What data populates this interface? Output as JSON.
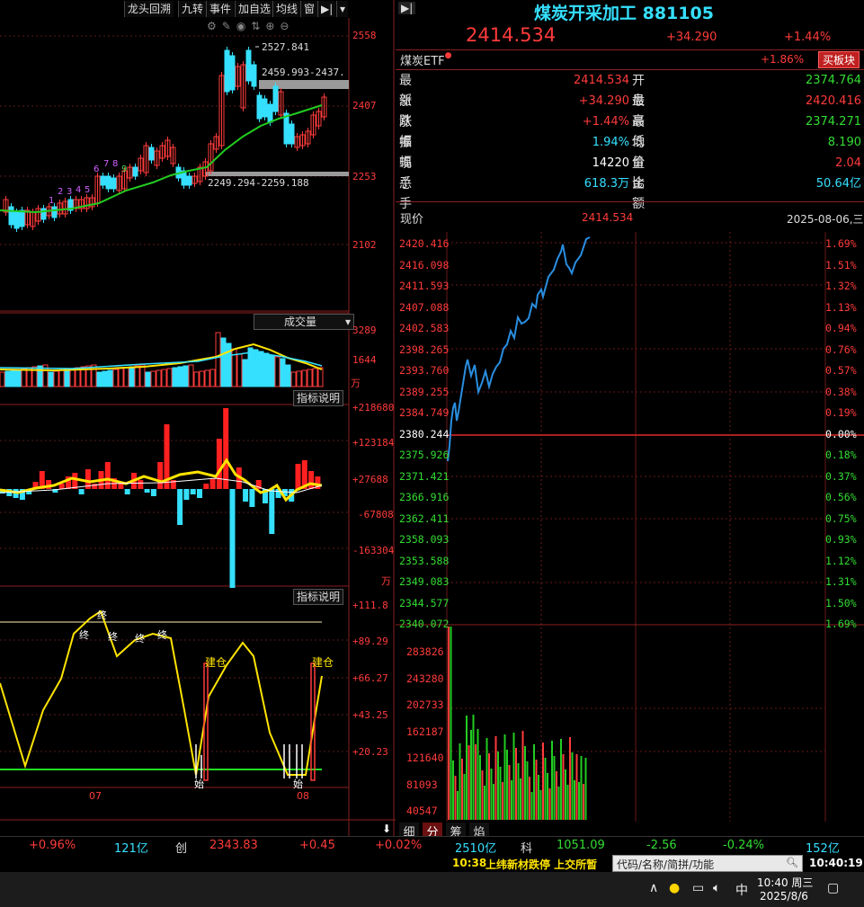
{
  "toolbar": {
    "buttons": [
      "龙头回溯",
      "九转",
      "事件",
      "加自选",
      "均线",
      "窗"
    ],
    "arrow_icon": "▶|",
    "dropdown_icon": "▾"
  },
  "kline": {
    "price_axis": [
      "2558",
      "2407",
      "2253",
      "2102"
    ],
    "high_label": "2527.841",
    "resistance_label": "2459.993-2437.",
    "support_label": "2249.294-2259.188",
    "seq_numbers": [
      "1",
      "2",
      "3",
      "4",
      "5",
      "6",
      "7",
      "8",
      "9"
    ],
    "month_labels": [
      "07",
      "08"
    ]
  },
  "volume": {
    "selector_label": "成交量",
    "axis": [
      "3289",
      "1644"
    ],
    "unit": "万"
  },
  "indicator1": {
    "button_label": "指标说明",
    "axis": [
      "+218680",
      "+123184",
      "+27688",
      "-67808",
      "-163304"
    ],
    "unit": "万"
  },
  "indicator2": {
    "button_label": "指标说明",
    "axis": [
      "+111.8",
      "+89.29",
      "+66.27",
      "+43.25",
      "+20.23"
    ],
    "build_label": "建仓",
    "top_label": "终",
    "bottom_label": "始"
  },
  "header": {
    "title": "煤炭开采加工 881105",
    "price": "2414.534",
    "change": "+34.290",
    "change_pct": "+1.44%"
  },
  "etf": {
    "name": "煤炭ETF",
    "change_pct": "+1.86%",
    "button": "买板块"
  },
  "quote": {
    "rows": [
      {
        "l1": "最新",
        "v1": "2414.534",
        "c1": "red",
        "l2": "开盘",
        "v2": "2374.764",
        "c2": "grn"
      },
      {
        "l1": "涨跌",
        "v1": "+34.290",
        "c1": "red",
        "l2": "最高",
        "v2": "2420.416",
        "c2": "red"
      },
      {
        "l1": "涨幅",
        "v1": "+1.44%",
        "c1": "red",
        "l2": "最低",
        "v2": "2374.271",
        "c2": "grn"
      },
      {
        "l1": "振幅",
        "v1": "1.94%",
        "c1": "cyan",
        "l2": "均价",
        "v2": "8.190",
        "c2": "grn"
      },
      {
        "l1": "现手",
        "v1": "14220",
        "c1": "wht",
        "l2": "量比",
        "v2": "2.04",
        "c2": "red"
      },
      {
        "l1": "总手",
        "v1": "618.3万",
        "c1": "cyan",
        "l2": "金额",
        "v2": "50.64亿",
        "c2": "cyan"
      }
    ]
  },
  "intraday": {
    "label": "现价",
    "price": "2414.534",
    "date": "2025-08-06,三",
    "price_axis": [
      "2420.416",
      "2416.098",
      "2411.593",
      "2407.088",
      "2402.583",
      "2398.265",
      "2393.760",
      "2389.255",
      "2384.749",
      "2380.244",
      "2375.926",
      "2371.421",
      "2366.916",
      "2362.411",
      "2358.093",
      "2353.588",
      "2349.083",
      "2344.577",
      "2340.072"
    ],
    "pct_axis": [
      "1.69%",
      "1.51%",
      "1.32%",
      "1.13%",
      "0.94%",
      "0.76%",
      "0.57%",
      "0.38%",
      "0.19%",
      "0.00%",
      "0.18%",
      "0.37%",
      "0.56%",
      "0.75%",
      "0.93%",
      "1.12%",
      "1.31%",
      "1.50%",
      "1.69%"
    ],
    "vol_axis": [
      "283826",
      "243280",
      "202733",
      "162187",
      "121640",
      "81093",
      "40547"
    ]
  },
  "bottom_tabs": [
    "细",
    "分",
    "筹",
    "焰"
  ],
  "status": {
    "items": [
      {
        "t": "+0.96%",
        "c": "red"
      },
      {
        "t": "121亿",
        "c": "cyan"
      },
      {
        "t": "创",
        "c": "wht"
      },
      {
        "t": "2343.83",
        "c": "red"
      },
      {
        "t": "+0.45",
        "c": "red"
      },
      {
        "t": "+0.02%",
        "c": "red"
      },
      {
        "t": "2510亿",
        "c": "cyan"
      },
      {
        "t": "科",
        "c": "wht"
      },
      {
        "t": "1051.09",
        "c": "grn"
      },
      {
        "t": "-2.56",
        "c": "grn"
      },
      {
        "t": "-0.24%",
        "c": "grn"
      },
      {
        "t": "152亿",
        "c": "cyan"
      }
    ]
  },
  "news": {
    "time": "10:38",
    "text": "上纬新材跌停 上交所暂",
    "search_placeholder": "代码/名称/简拼/功能",
    "clock": "10:40:19"
  },
  "taskbar": {
    "ime": "中",
    "time": "10:40 周三",
    "date": "2025/8/6"
  },
  "colors": {
    "up": "#ff3b3b",
    "down": "#35e0ff",
    "ma": "#22cc22",
    "price_line": "#2a8ee0"
  }
}
